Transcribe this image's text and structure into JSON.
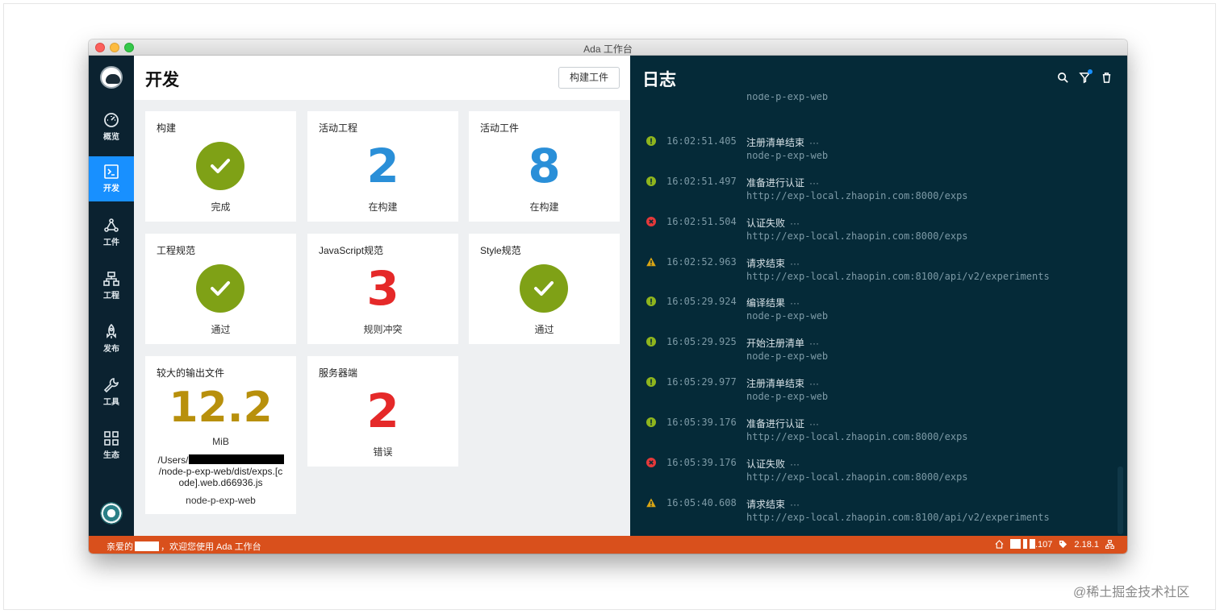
{
  "window": {
    "title": "Ada 工作台"
  },
  "sidebar": {
    "items": [
      {
        "label": "概览",
        "icon": "dashboard-icon"
      },
      {
        "label": "开发",
        "icon": "terminal-icon"
      },
      {
        "label": "工件",
        "icon": "graph-icon"
      },
      {
        "label": "工程",
        "icon": "sitemap-icon"
      },
      {
        "label": "发布",
        "icon": "rocket-icon"
      },
      {
        "label": "工具",
        "icon": "wrench-icon"
      },
      {
        "label": "生态",
        "icon": "grid-icon"
      }
    ],
    "active_color": "#1890ff"
  },
  "dev": {
    "title": "开发",
    "build_button": "构建工件",
    "cards": [
      {
        "title": "构建",
        "status": "完成",
        "kind": "check"
      },
      {
        "title": "活动工程",
        "value": "2",
        "status": "在构建"
      },
      {
        "title": "活动工件",
        "value": "8",
        "status": "在构建"
      },
      {
        "title": "工程规范",
        "status": "通过",
        "kind": "check"
      },
      {
        "title": "JavaScript规范",
        "value": "3",
        "status": "规则冲突"
      },
      {
        "title": "Style规范",
        "status": "通过",
        "kind": "check"
      },
      {
        "title": "较大的输出文件",
        "value": "12.2",
        "unit": "MiB",
        "path_prefix": "/Users/",
        "path_suffix": "/node-p-exp-web/dist/exps.[code].web.d66936.js",
        "project": "node-p-exp-web"
      },
      {
        "title": "服务器端",
        "value": "2",
        "status": "错误"
      }
    ]
  },
  "log": {
    "title": "日志",
    "tools": [
      "search-icon",
      "filter-icon",
      "trash-icon"
    ],
    "entries": [
      {
        "level": "info",
        "time": "16:02:51.405",
        "message": "注册清单结束",
        "detail": "node-p-exp-web"
      },
      {
        "level": "info",
        "time": "16:02:51.497",
        "message": "准备进行认证",
        "detail": "http://exp-local.zhaopin.com:8000/exps"
      },
      {
        "level": "error",
        "time": "16:02:51.504",
        "message": "认证失败",
        "detail": "http://exp-local.zhaopin.com:8000/exps"
      },
      {
        "level": "warning",
        "time": "16:02:52.963",
        "message": "请求结束",
        "detail": "http://exp-local.zhaopin.com:8100/api/v2/experiments"
      },
      {
        "level": "info",
        "time": "16:05:29.924",
        "message": "编译结果",
        "detail": "node-p-exp-web"
      },
      {
        "level": "info",
        "time": "16:05:29.925",
        "message": "开始注册清单",
        "detail": "node-p-exp-web"
      },
      {
        "level": "info",
        "time": "16:05:29.977",
        "message": "注册清单结束",
        "detail": "node-p-exp-web"
      },
      {
        "level": "info",
        "time": "16:05:39.176",
        "message": "准备进行认证",
        "detail": "http://exp-local.zhaopin.com:8000/exps"
      },
      {
        "level": "error",
        "time": "16:05:39.176",
        "message": "认证失败",
        "detail": "http://exp-local.zhaopin.com:8000/exps"
      },
      {
        "level": "warning",
        "time": "16:05:40.608",
        "message": "请求结束",
        "detail": "http://exp-local.zhaopin.com:8100/api/v2/experiments"
      }
    ],
    "partial_top_detail": "node-p-exp-web",
    "more_label": "···"
  },
  "status": {
    "welcome_prefix": "亲爱的",
    "welcome_suffix": "，欢迎您使用 Ada 工作台",
    "ip_suffix": ".107",
    "version": "2.18.1",
    "color": "#d9501c"
  },
  "watermark": "@稀土掘金技术社区"
}
